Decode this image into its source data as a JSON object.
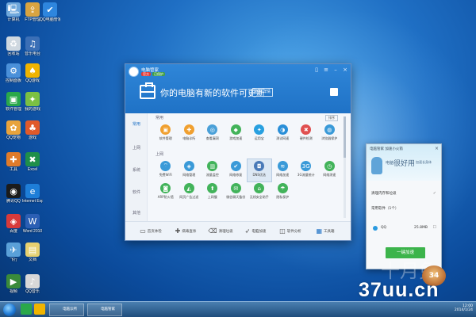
{
  "desktop": {
    "icons": [
      {
        "label": "计算机",
        "icon": "computer-icon",
        "color": "#6fa8dc"
      },
      {
        "label": "FTP管理",
        "icon": "ftp-icon",
        "color": "#d9a441"
      },
      {
        "label": "QQ电脑管家",
        "icon": "shield-icon",
        "color": "#2e86de"
      },
      {
        "label": "回收站",
        "icon": "recycle-bin-icon",
        "color": "#cfd8e0"
      },
      {
        "label": "音乐电台",
        "icon": "music-icon",
        "color": "#3b6fb6"
      },
      {
        "label": "控制面板",
        "icon": "control-panel-icon",
        "color": "#4a90d9"
      },
      {
        "label": "QQ游戏",
        "icon": "qq-game-icon",
        "color": "#f0b400"
      },
      {
        "label": "软件管理",
        "icon": "software-icon",
        "color": "#2aa84a"
      },
      {
        "label": "我的游戏",
        "icon": "game-icon",
        "color": "#7bc043"
      },
      {
        "label": "QQ宠物",
        "icon": "pet-icon",
        "color": "#e8a33c"
      },
      {
        "label": "游戏",
        "icon": "game-controller-icon",
        "color": "#e05a2a"
      },
      {
        "label": "工具",
        "icon": "toolbox-icon",
        "color": "#e07b2a"
      },
      {
        "label": "Excel",
        "icon": "excel-icon",
        "color": "#1f8f4a"
      },
      {
        "label": "腾讯QQ",
        "icon": "qq-icon",
        "color": "#1b1b1b"
      },
      {
        "label": "Internet Explorer",
        "icon": "ie-icon",
        "color": "#1e7ed8"
      },
      {
        "label": "百度",
        "icon": "baidu-icon",
        "color": "#d83a3a"
      },
      {
        "label": "Word 2010",
        "icon": "word-icon",
        "color": "#2b5fb4"
      },
      {
        "label": "飞行",
        "icon": "plane-icon",
        "color": "#5aa0d8"
      },
      {
        "label": "文档",
        "icon": "document-icon",
        "color": "#e6d070"
      },
      {
        "label": "视频",
        "icon": "video-icon",
        "color": "#3a8a3a"
      },
      {
        "label": "QQ音乐",
        "icon": "qq-music-icon",
        "color": "#d8d8d8"
      }
    ]
  },
  "manager": {
    "app_name": "电脑管家",
    "badges": [
      {
        "text": "官方",
        "color": "#e53935"
      },
      {
        "text": "已保护",
        "color": "#43a047"
      }
    ],
    "update_text": "你的电脑有新的软件可更新",
    "detail_button": "查看详情",
    "sidebar": [
      "常用",
      "上网",
      "系统",
      "软件",
      "其他"
    ],
    "sections": [
      {
        "label": "常用",
        "tools": [
          {
            "label": "软件管理",
            "icon": "software-icon",
            "color": "#f0a030"
          },
          {
            "label": "电脑诊所",
            "icon": "clinic-icon",
            "color": "#f0a030"
          },
          {
            "label": "查看漏洞",
            "icon": "vulnerability-icon",
            "color": "#4aa0d8"
          },
          {
            "label": "游戏加速",
            "icon": "game-accel-icon",
            "color": "#42b35a"
          },
          {
            "label": "运用宝",
            "icon": "app-store-icon",
            "color": "#28a0e0"
          },
          {
            "label": "测试网速",
            "icon": "speed-test-icon",
            "color": "#2a8fd8"
          },
          {
            "label": "硬件检测",
            "icon": "hardware-icon",
            "color": "#e05050"
          },
          {
            "label": "浏览器保护",
            "icon": "browser-protect-icon",
            "color": "#3a9ad8"
          }
        ]
      },
      {
        "label": "上网",
        "tools": [
          {
            "label": "免费WiFi",
            "icon": "wifi-icon",
            "color": "#3a9ad8"
          },
          {
            "label": "网络管理",
            "icon": "network-icon",
            "color": "#3a9ad8"
          },
          {
            "label": "流量监控",
            "icon": "traffic-icon",
            "color": "#42b35a"
          },
          {
            "label": "网络修复",
            "icon": "repair-icon",
            "color": "#3a9ad8"
          },
          {
            "label": "DNS优选",
            "icon": "dns-icon",
            "color": "#4a7ab8"
          },
          {
            "label": "网络加速",
            "icon": "net-accel-icon",
            "color": "#3a9ad8"
          },
          {
            "label": "3G流量统计",
            "icon": "3g-icon",
            "color": "#3a9ad8"
          },
          {
            "label": "网络测速",
            "icon": "net-speed-icon",
            "color": "#42b35a"
          },
          {
            "label": "ARP防火墙",
            "icon": "arp-firewall-icon",
            "color": "#42b35a"
          },
          {
            "label": "网页广告过滤",
            "icon": "ad-filter-icon",
            "color": "#42b35a"
          },
          {
            "label": "上网慢",
            "icon": "slow-net-icon",
            "color": "#42b35a"
          },
          {
            "label": "微信聊天备份",
            "icon": "wechat-backup-icon",
            "color": "#42b35a"
          },
          {
            "label": "无线安全助手",
            "icon": "wireless-icon",
            "color": "#42b35a"
          },
          {
            "label": "隐私保护",
            "icon": "privacy-icon",
            "color": "#42b35a"
          }
        ]
      }
    ],
    "sort_button": "排序",
    "bottom_nav": [
      {
        "label": "首页体检",
        "icon": "home-icon"
      },
      {
        "label": "病毒查杀",
        "icon": "virus-scan-icon"
      },
      {
        "label": "清理垃圾",
        "icon": "clean-icon"
      },
      {
        "label": "电脑加速",
        "icon": "rocket-icon"
      },
      {
        "label": "软件分析",
        "icon": "software-analysis-icon"
      },
      {
        "label": "工具箱",
        "icon": "toolbox-icon"
      }
    ],
    "brand_color": "#1f72c6"
  },
  "accelerator": {
    "title": "电脑管家  加速小火箭",
    "slogan_a": "电脑",
    "slogan_b": "很好用",
    "slogan_c": "加速长身体",
    "row1": "清理内存和垃圾",
    "row2": "常用软件（1个）",
    "process_name": "QQ",
    "process_mem": "25.8MB",
    "button": "一键加速",
    "button_color": "#3cb44b"
  },
  "taskbar": {
    "tasks": [
      "电脑诊所",
      "电脑管家"
    ],
    "clock_time": "12:00",
    "clock_date": "2014/1/24"
  },
  "watermark": {
    "text": "37uu.cn",
    "bg_text": "十月兔",
    "badge_text": "34"
  }
}
